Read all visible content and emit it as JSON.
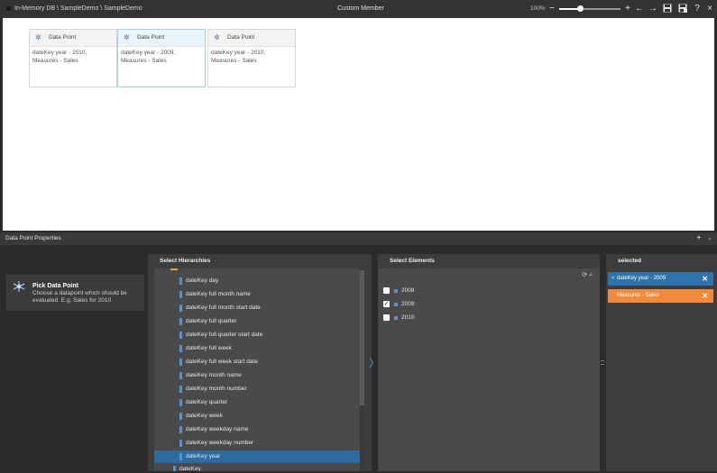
{
  "topbar": {
    "path": "In-Memory DB \\ SampleDemo \\ SampleDemo",
    "title": "Custom Member",
    "zoom": "100%",
    "zoom_fraction": 0.35
  },
  "canvas": {
    "cards": [
      {
        "title": "Data Point",
        "text": "dateKey year - 2010, Measures - Sales"
      },
      {
        "title": "Data Point",
        "text": "dateKey year - 2009, Measures - Sales"
      },
      {
        "title": "Data Point",
        "text": "dateKey year - 2010, Measures - Sales"
      }
    ]
  },
  "properties": {
    "title": "Data Point Properties",
    "pick_title": "Pick Data Point",
    "pick_desc": "Choose a datapoint which should be evaluated. E.g. Sales for 2010"
  },
  "hierarchies": {
    "title": "Select Hierarchies",
    "items": [
      "dateKey day",
      "dateKey full month name",
      "dateKey full month start date",
      "dateKey full quarter",
      "dateKey full quarter start date",
      "dateKey full week",
      "dateKey full week start date",
      "dateKey month name",
      "dateKey month number",
      "dateKey quarter",
      "dateKey week",
      "dateKey weekday name",
      "dateKey weekday number",
      "dateKey year"
    ],
    "next_parent": "dateKey"
  },
  "elements": {
    "title": "Select Elements",
    "items": [
      {
        "label": "2008",
        "checked": false
      },
      {
        "label": "2009",
        "checked": true
      },
      {
        "label": "2010",
        "checked": false
      }
    ]
  },
  "selected": {
    "title": "selected",
    "chips": [
      {
        "label": "dateKey year - 2009",
        "color": "#2f73ad"
      },
      {
        "label": "Measures - Sales",
        "color": "#f08a3c"
      }
    ]
  }
}
